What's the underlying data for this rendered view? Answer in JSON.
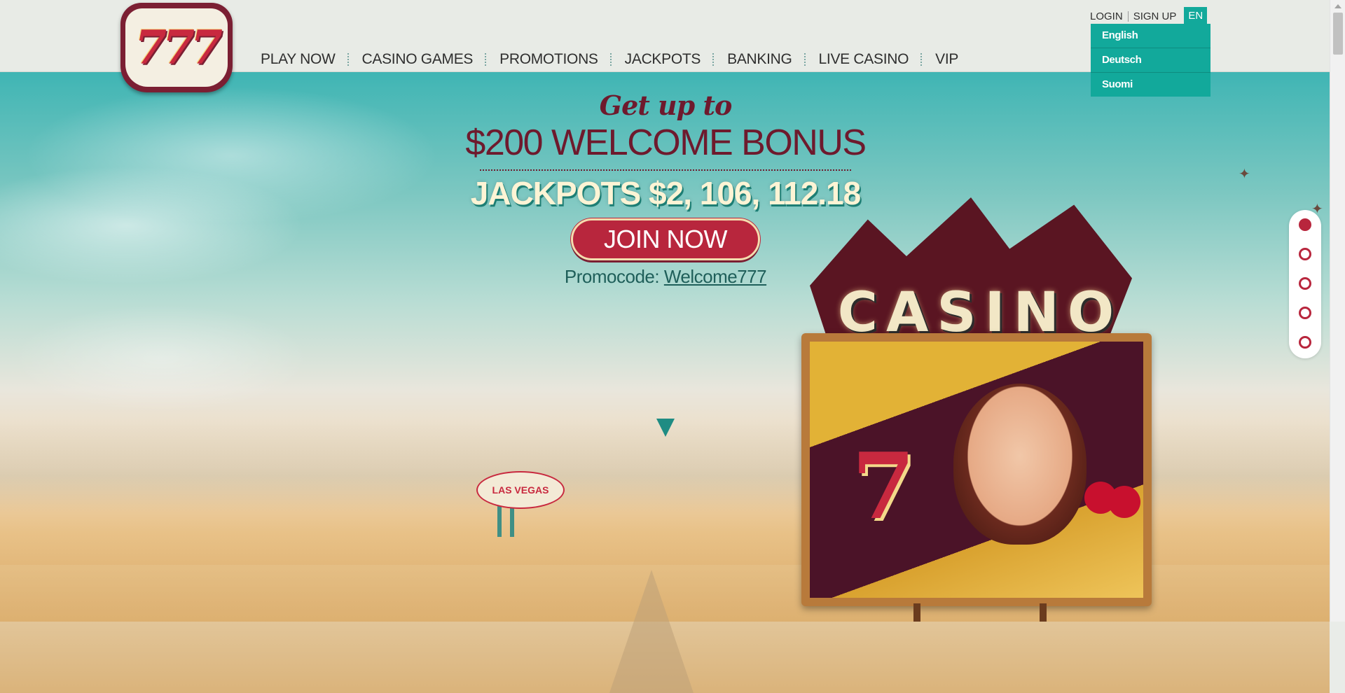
{
  "header": {
    "logo_text": "777",
    "nav": [
      {
        "label": "PLAY NOW"
      },
      {
        "label": "CASINO GAMES"
      },
      {
        "label": "PROMOTIONS"
      },
      {
        "label": "JACKPOTS"
      },
      {
        "label": "BANKING"
      },
      {
        "label": "LIVE CASINO"
      },
      {
        "label": "VIP"
      }
    ],
    "login_label": "LOGIN",
    "signup_label": "SIGN UP",
    "language_current": "EN",
    "language_options": [
      {
        "label": "English"
      },
      {
        "label": "Deutsch"
      },
      {
        "label": "Suomi"
      }
    ]
  },
  "promo": {
    "get_up_to": "Get up to",
    "welcome_bonus": "$200 WELCOME BONUS",
    "jackpots": "JACKPOTS $2, 106, 112.18",
    "join_button": "JOIN NOW",
    "promocode_label": "Promocode:",
    "promocode_value": "Welcome777"
  },
  "illustration": {
    "casino_sign": "CASINO",
    "vegas_sign": "LAS VEGAS"
  },
  "slider": {
    "slide_count": 5,
    "active_index": 0
  },
  "colors": {
    "brand_red": "#b8263d",
    "brand_maroon": "#6e1a2d",
    "accent_teal": "#12a99b"
  }
}
